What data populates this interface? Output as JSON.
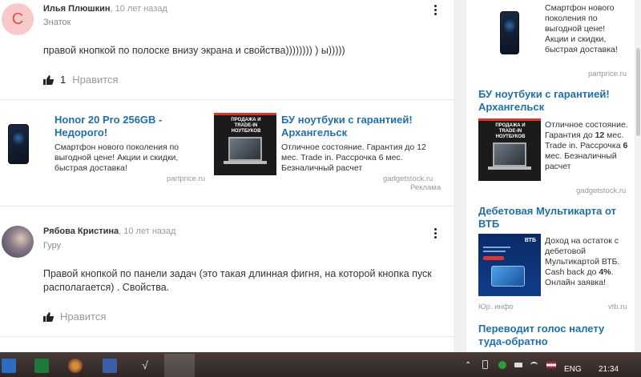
{
  "answers": [
    {
      "avatar_letter": "С",
      "author": "Илья Плюшкин",
      "when": "10 лет назад",
      "rank": "Знаток",
      "text": "правой кнопкой по полоске внизу экрана и свойства)))))))) ) ы)))))",
      "likes": "1",
      "like_label": "Нравится"
    },
    {
      "author": "Рябова Кристина",
      "when": "10 лет назад",
      "rank": "Гуру",
      "text": "Правой кнопкой по панели задач (это такая длинная фигня, на которой кнопка пуск располагается) . Свойства.",
      "like_label": "Нравится"
    }
  ],
  "inline_ads": [
    {
      "title": "Honor 20 Pro 256GB - Недорого!",
      "desc": "Смартфон нового поколения по выгодной цене! Акции и скидки, быстрая доставка!",
      "domain": "partprice.ru"
    },
    {
      "title": "БУ ноутбуки с гарантией! Архангельск",
      "desc": "Отличное состояние. Гарантия до 12 мес. Trade in. Рассрочка 6 мес. Безналичный расчет",
      "domain": "gadgetstock.ru",
      "image_text": "ПРОДАЖА И TRADE-IN НОУТБУКОВ"
    }
  ],
  "ad_label": "Реклама",
  "sidebar_ads": [
    {
      "desc": "Смартфон нового поколения по выгодной цене! Акции и скидки, быстрая доставка!",
      "domain": "partprice.ru"
    },
    {
      "title": "БУ ноутбуки с гарантией! Архангельск",
      "desc_a": "Отличное состояние. Гарантия до ",
      "desc_b": "12",
      "desc_c": " мес. Trade in. Рассрочка ",
      "desc_d": "6",
      "desc_e": " мес. Безналичный расчет",
      "domain": "gadgetstock.ru",
      "image_text": "ПРОДАЖА И TRADE-IN НОУТБУКОВ"
    },
    {
      "title": "Дебетовая Мультикарта от ВТБ",
      "desc_a": "Доход на остаток с дебетовой Мультикартой ВТБ. Cash back до ",
      "desc_b": "4%",
      "desc_c": ". Онлайн заявка!",
      "source": "Юр. инфо",
      "domain": "vtb.ru",
      "image_brand": "ВТБ"
    },
    {
      "title": "Переводит голос налету туда-обратно"
    }
  ],
  "taskbar": {
    "lang": "ENG",
    "time": "21:34"
  },
  "colors": {
    "link": "#1e6fb0",
    "avatar_bg": "#f7c9c9",
    "avatar_fg": "#d9534f"
  }
}
